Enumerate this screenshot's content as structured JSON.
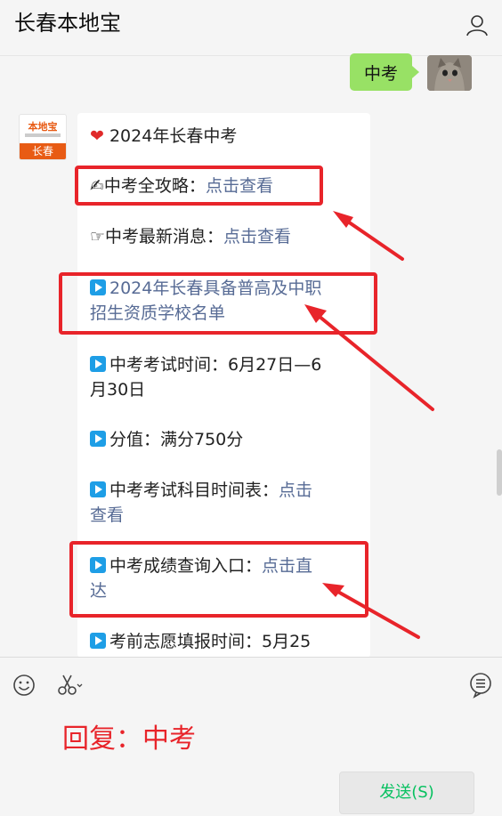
{
  "header": {
    "title": "长春本地宝"
  },
  "chat": {
    "sent_message": "中考",
    "avatar": {
      "logo": "本地宝",
      "city": "长春"
    },
    "card": {
      "l1": "2024年长春中考",
      "l2_text": "中考全攻略：",
      "l2_link": "点击查看",
      "l3_text": "☞中考最新消息：",
      "l3_link": "点击查看",
      "l4_line1": "2024年长春具备普高及中职",
      "l4_line2": "招生资质学校名单",
      "l5_line1": "中考考试时间：6月27日—6",
      "l5_line2": "月30日",
      "l6": "分值：满分750分",
      "l7_text": "中考考试科目时间表：",
      "l7_link": "点击",
      "l7_link2": "查看",
      "l8_text": "中考成绩查询入口：",
      "l8_link": "点击直",
      "l8_link2": "达",
      "l9": "考前志愿填报时间：5月25"
    }
  },
  "input": {
    "reply_hint": "回复：中考",
    "send_label": "发送(S)"
  }
}
